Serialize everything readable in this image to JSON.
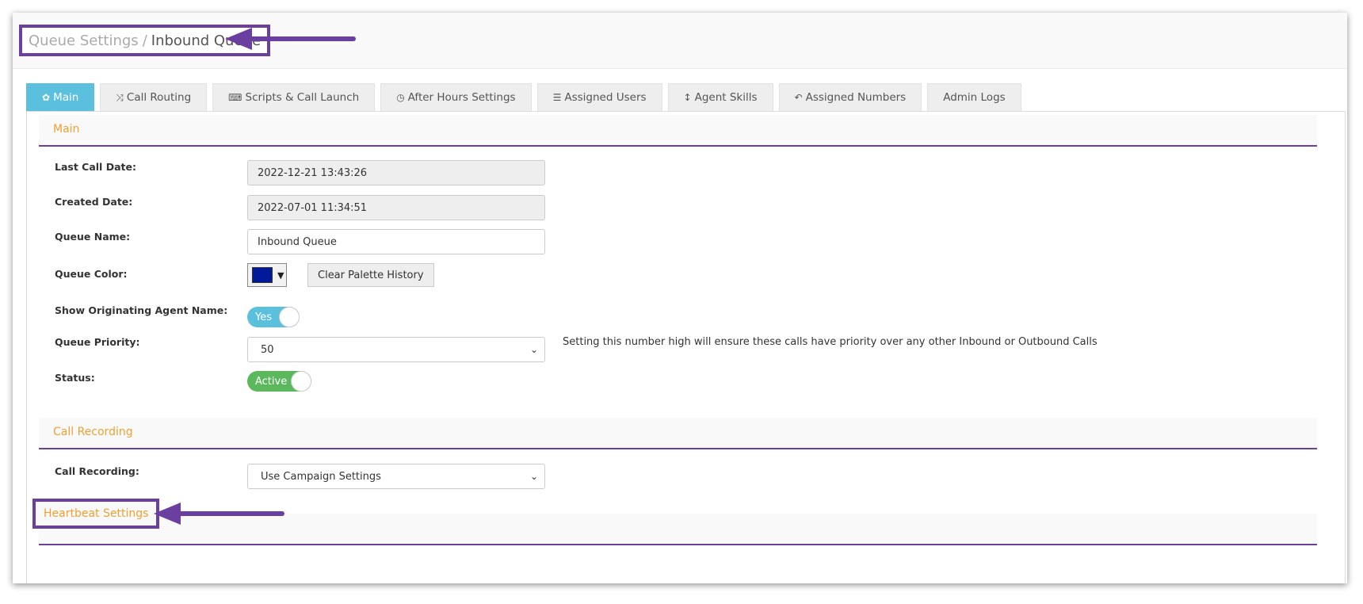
{
  "breadcrumb": {
    "parent": "Queue Settings",
    "separator": "/",
    "current": "Inbound Queue"
  },
  "tabs": [
    {
      "label": "Main",
      "icon": "gear-icon",
      "glyph": "✿",
      "active": true
    },
    {
      "label": "Call Routing",
      "icon": "shuffle-icon",
      "glyph": "⤨",
      "active": false
    },
    {
      "label": "Scripts & Call Launch",
      "icon": "keyboard-icon",
      "glyph": "⌨",
      "active": false
    },
    {
      "label": "After Hours Settings",
      "icon": "clock-icon",
      "glyph": "◷",
      "active": false
    },
    {
      "label": "Assigned Users",
      "icon": "list-icon",
      "glyph": "☰",
      "active": false
    },
    {
      "label": "Agent Skills",
      "icon": "vertical-arrows-icon",
      "glyph": "↕",
      "active": false
    },
    {
      "label": "Assigned Numbers",
      "icon": "reply-all-icon",
      "glyph": "↶",
      "active": false
    },
    {
      "label": "Admin Logs",
      "icon": "",
      "glyph": "",
      "active": false
    }
  ],
  "main": {
    "title": "Main",
    "last_call_date_label": "Last Call Date:",
    "last_call_date": "2022-12-21 13:43:26",
    "created_date_label": "Created Date:",
    "created_date": "2022-07-01 11:34:51",
    "queue_name_label": "Queue Name:",
    "queue_name": "Inbound Queue",
    "queue_color_label": "Queue Color:",
    "queue_color": "#001a99",
    "clear_palette_label": "Clear Palette History",
    "show_agent_label": "Show Originating Agent Name:",
    "show_agent_value": "Yes",
    "priority_label": "Queue Priority:",
    "priority_value": "50",
    "priority_hint": "Setting this number high will ensure these calls have priority over any other Inbound or Outbound Calls",
    "status_label": "Status:",
    "status_value": "Active"
  },
  "call_recording": {
    "title": "Call Recording",
    "label": "Call Recording:",
    "value": "Use Campaign Settings"
  },
  "heartbeat": {
    "title": "Heartbeat Settings"
  },
  "colors": {
    "accent_purple": "#6b3fa0",
    "section_orange": "#f0a030",
    "tab_active": "#5bc0de",
    "toggle_yes": "#5bc0de",
    "toggle_active": "#5cb85c"
  }
}
